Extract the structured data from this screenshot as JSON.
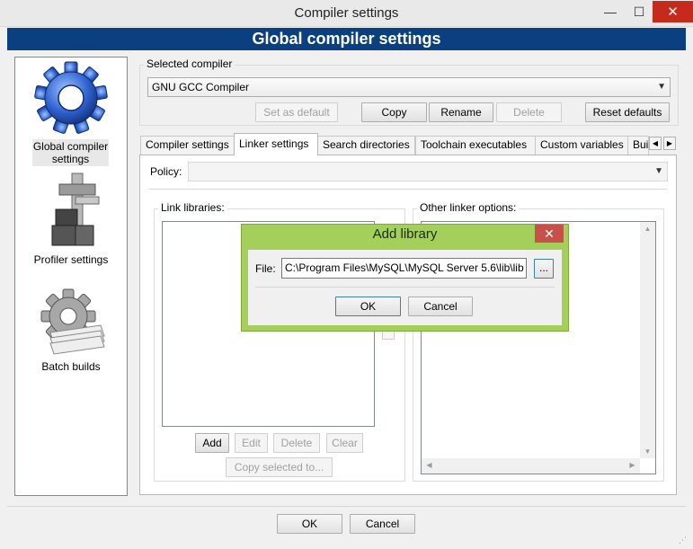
{
  "window": {
    "title": "Compiler settings",
    "min_glyph": "—",
    "max_glyph": "☐",
    "close_glyph": "✕"
  },
  "banner": {
    "title": "Global compiler settings"
  },
  "sidebar": {
    "items": [
      {
        "label": "Global compiler settings",
        "icon": "gear-icon",
        "selected": true
      },
      {
        "label": "Profiler settings",
        "icon": "caliper-icon",
        "selected": false
      },
      {
        "label": "Batch builds",
        "icon": "batch-gear-icon",
        "selected": false
      }
    ]
  },
  "compiler": {
    "group_label": "Selected compiler",
    "selected": "GNU GCC Compiler",
    "buttons": {
      "set_default": "Set as default",
      "copy": "Copy",
      "rename": "Rename",
      "delete": "Delete",
      "reset": "Reset defaults"
    }
  },
  "tabs": [
    {
      "label": "Compiler settings",
      "active": false
    },
    {
      "label": "Linker settings",
      "active": true
    },
    {
      "label": "Search directories",
      "active": false
    },
    {
      "label": "Toolchain executables",
      "active": false
    },
    {
      "label": "Custom variables",
      "active": false
    },
    {
      "label": "Bui",
      "active": false
    }
  ],
  "tab_scroll": {
    "left": "◀",
    "right": "▶"
  },
  "linker": {
    "policy_label": "Policy:",
    "policy_value": "",
    "link_libraries_label": "Link libraries:",
    "other_options_label": "Other linker options:",
    "buttons": {
      "add": "Add",
      "edit": "Edit",
      "delete": "Delete",
      "clear": "Clear",
      "copy_selected": "Copy selected to..."
    }
  },
  "dialog": {
    "title": "Add library",
    "close_glyph": "✕",
    "file_label": "File:",
    "file_value": "C:\\Program Files\\MySQL\\MySQL Server 5.6\\lib\\lib",
    "browse_label": "...",
    "ok": "OK",
    "cancel": "Cancel"
  },
  "footer": {
    "ok": "OK",
    "cancel": "Cancel"
  },
  "colors": {
    "banner": "#0a3f80",
    "dialog_frame": "#a3cf5a",
    "close_red": "#c42b1c"
  }
}
